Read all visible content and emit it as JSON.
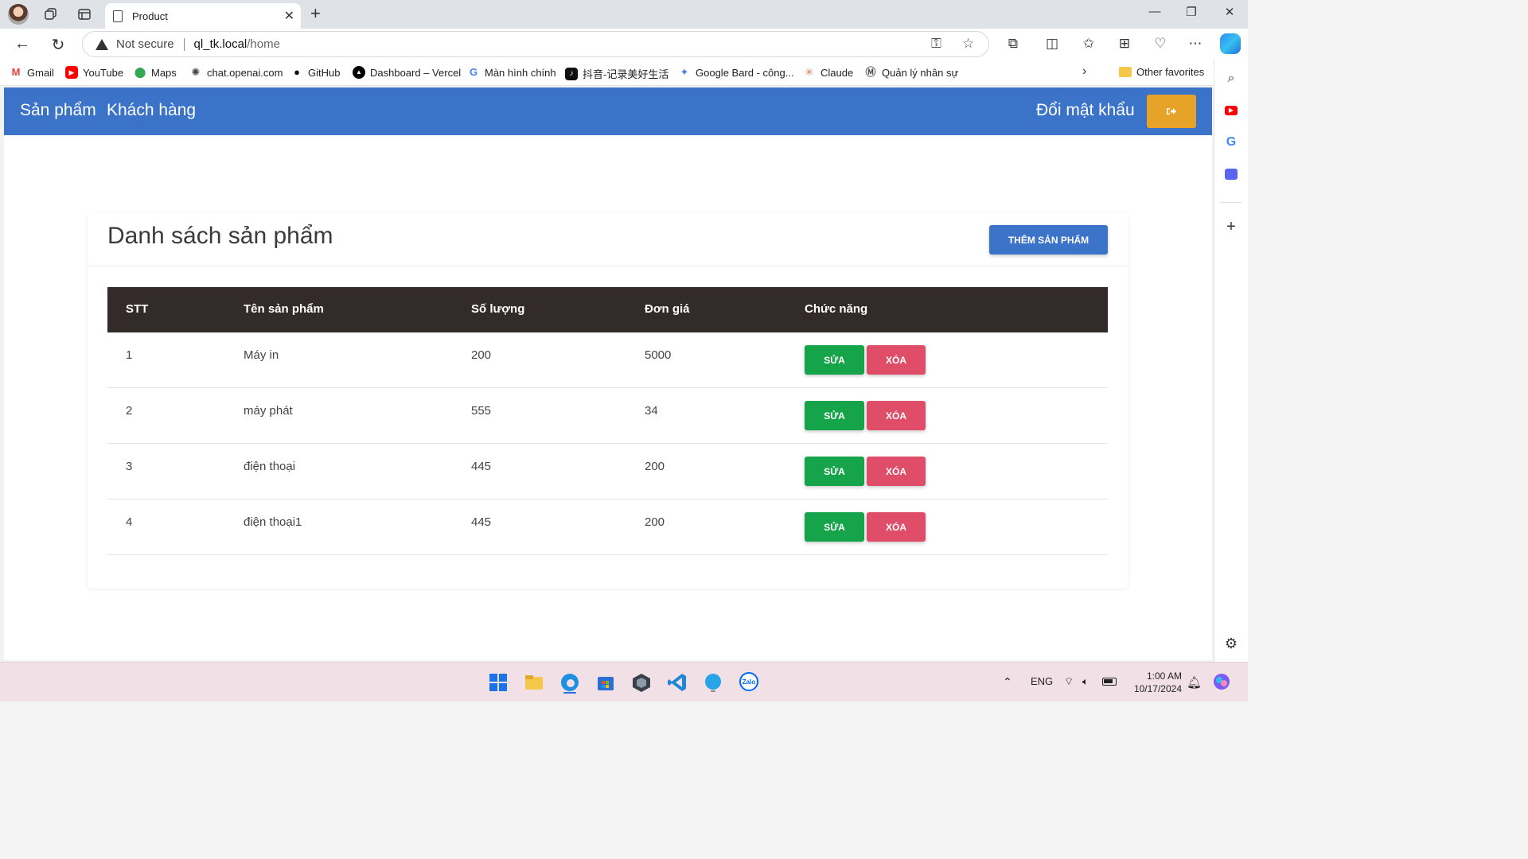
{
  "browser": {
    "tab_title": "Product",
    "address": {
      "security_label": "Not secure",
      "host": "ql_tk.local",
      "path": "/home"
    },
    "favorites": [
      {
        "label": "Gmail",
        "icon": "gmail-icon",
        "color": "#ea4335"
      },
      {
        "label": "YouTube",
        "icon": "youtube-icon",
        "color": "#ff0000"
      },
      {
        "label": "Maps",
        "icon": "maps-icon",
        "color": "#34a853"
      },
      {
        "label": "chat.openai.com",
        "icon": "openai-icon",
        "color": "#444444"
      },
      {
        "label": "GitHub",
        "icon": "github-icon",
        "color": "#111111"
      },
      {
        "label": "Dashboard – Vercel",
        "icon": "vercel-icon",
        "color": "#000000"
      },
      {
        "label": "Màn hình chính",
        "icon": "google-icon",
        "color": "#4285f4"
      },
      {
        "label": "抖音-记录美好生活",
        "icon": "tiktok-icon",
        "color": "#111111"
      },
      {
        "label": "Google Bard - công...",
        "icon": "bard-icon",
        "color": "#4b7bec"
      },
      {
        "label": "Claude",
        "icon": "claude-icon",
        "color": "#d97757"
      },
      {
        "label": "Quản lý nhân sự",
        "icon": "app-icon",
        "color": "#555555"
      }
    ],
    "other_favorites": "Other favorites"
  },
  "app": {
    "nav": {
      "products": "Sản phẩm",
      "customers": "Khách hàng",
      "change_password": "Đổi mật khẩu",
      "logout_icon": "logout-icon"
    },
    "page_title": "Danh sách sản phẩm",
    "add_button": "THÊM SẢN PHẨM",
    "columns": [
      "STT",
      "Tên sản phẩm",
      "Số lượng",
      "Đơn giá",
      "Chức năng"
    ],
    "rows": [
      {
        "stt": "1",
        "name": "Máy in",
        "qty": "200",
        "price": "5000"
      },
      {
        "stt": "2",
        "name": "máy phát",
        "qty": "555",
        "price": "34"
      },
      {
        "stt": "3",
        "name": "điện thoại",
        "qty": "445",
        "price": "200"
      },
      {
        "stt": "4",
        "name": "điện thoại1",
        "qty": "445",
        "price": "200"
      }
    ],
    "edit_label": "SỬA",
    "delete_label": "XÓA",
    "colors": {
      "primary": "#3b73c9",
      "warning": "#e6a328",
      "success": "#16a44a",
      "danger": "#df4d68",
      "table_header": "#332b29"
    }
  },
  "taskbar": {
    "language": "ENG",
    "time": "1:00 AM",
    "date": "10/17/2024"
  }
}
